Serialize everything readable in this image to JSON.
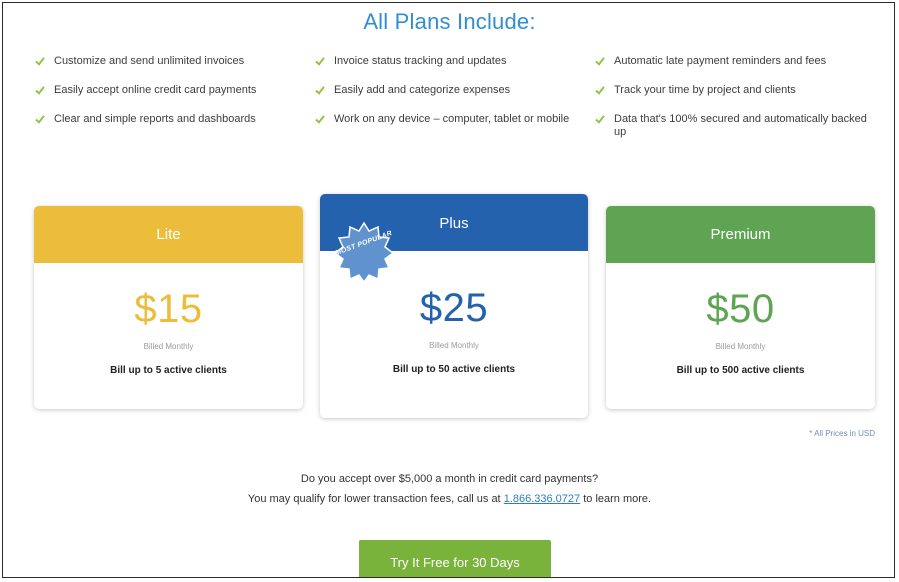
{
  "heading": "All Plans Include:",
  "features": [
    "Customize and send unlimited invoices",
    "Invoice status tracking and updates",
    "Automatic late payment reminders and fees",
    "Easily accept online credit card payments",
    "Easily add and categorize expenses",
    "Track your time by project and clients",
    "Clear and simple reports and dashboards",
    "Work on any device – computer, tablet or mobile",
    "Data that's 100% secured and automatically backed up"
  ],
  "colors": {
    "heading": "#2f8fd1",
    "check": "#8dc63f",
    "lite": "#ecbd3b",
    "plus": "#2462ad",
    "premium": "#5ea452",
    "cta": "#7ab33c"
  },
  "plans": [
    {
      "name": "Lite",
      "price": "$15",
      "billing": "Billed Monthly",
      "clients": "Bill up to 5 active clients"
    },
    {
      "name": "Plus",
      "price": "$25",
      "billing": "Billed Monthly",
      "clients": "Bill up to 50 active clients",
      "badge": "MOST POPULAR"
    },
    {
      "name": "Premium",
      "price": "$50",
      "billing": "Billed Monthly",
      "clients": "Bill up to 500 active clients"
    }
  ],
  "currency_note": "* All Prices in USD",
  "transaction_note": {
    "line1": "Do you accept over $5,000 a month in credit card payments?",
    "line2_prefix": "You may qualify for lower transaction fees, call us at",
    "phone": "1.866.336.0727",
    "line2_suffix": "to learn more."
  },
  "cta_label": "Try It Free for 30 Days",
  "icons": {
    "check": "check-icon",
    "badge": "starburst-badge-icon"
  }
}
